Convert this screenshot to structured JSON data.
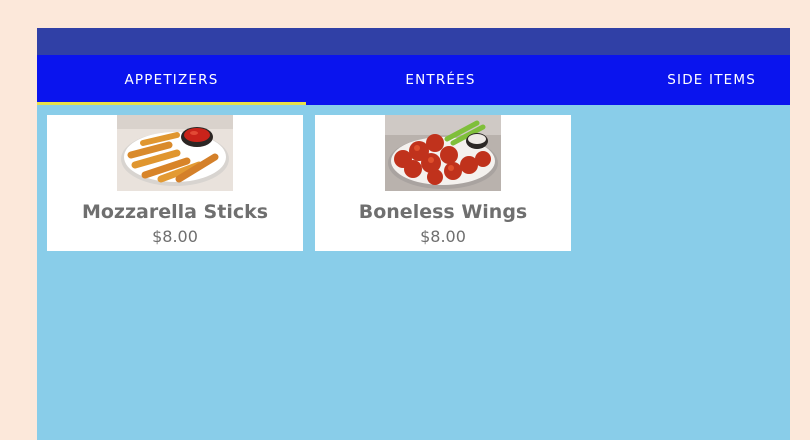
{
  "tabs": [
    {
      "label": "APPETIZERS",
      "selected": true
    },
    {
      "label": "ENTRÉES",
      "selected": false
    },
    {
      "label": "SIDE ITEMS",
      "selected": false
    }
  ],
  "menu_items": [
    {
      "name": "Mozzarella Sticks",
      "price": "$8.00",
      "image": "mozzarella-sticks-photo"
    },
    {
      "name": "Boneless Wings",
      "price": "$8.00",
      "image": "boneless-wings-photo"
    }
  ],
  "colors": {
    "page_background": "#fce8da",
    "app_bar": "#3040a6",
    "tab_bar": "#0a14ee",
    "tab_indicator": "#e8e04a",
    "content_background": "#89cde9",
    "card_text": "#6f6f6f"
  }
}
